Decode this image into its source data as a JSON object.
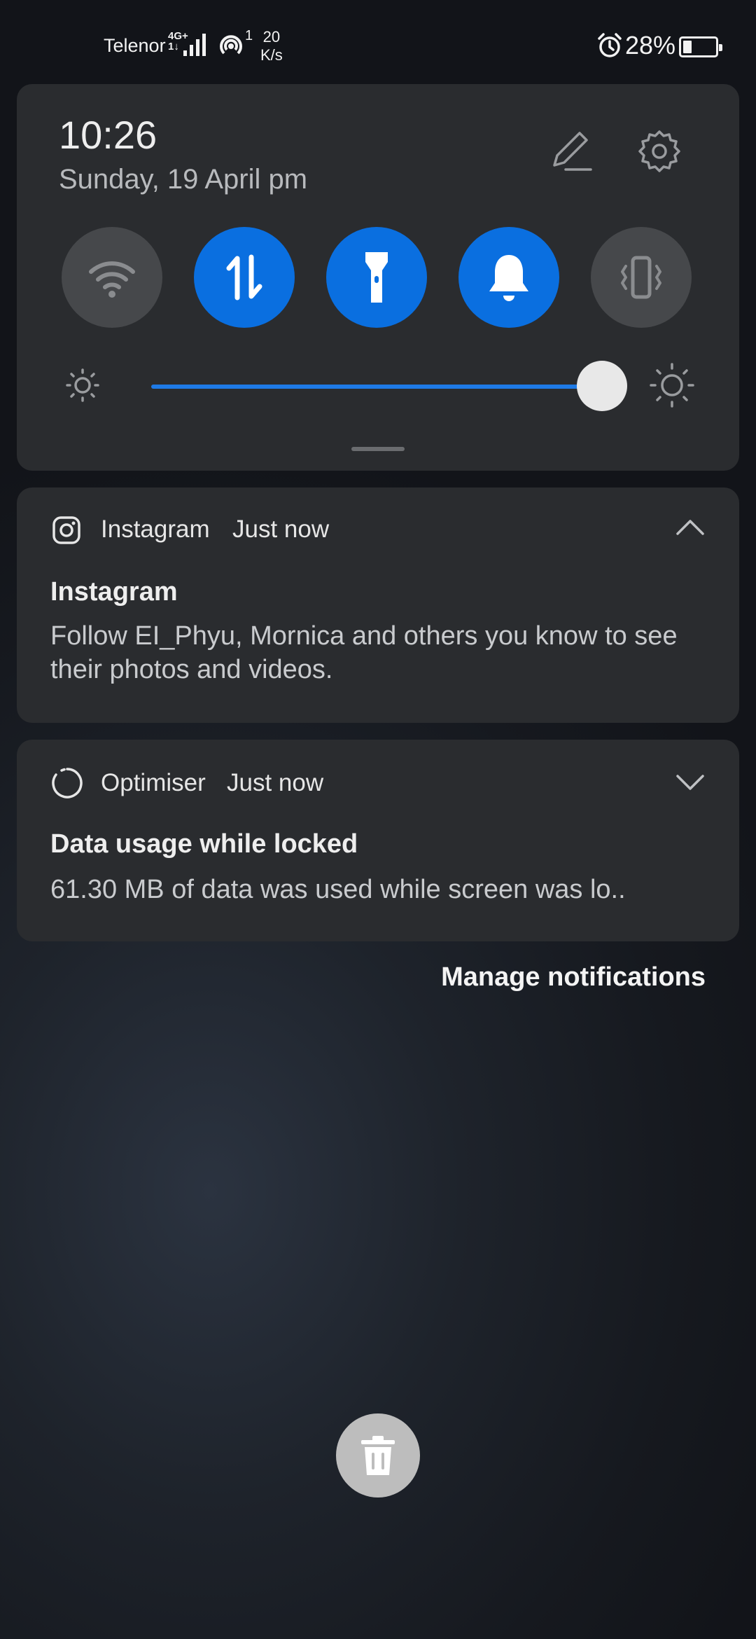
{
  "status_bar": {
    "carrier": "Telenor",
    "network_type": "4G+",
    "network_sub": "1↓",
    "hotspot_count": "1",
    "speed_value": "20",
    "speed_unit": "K/s",
    "battery_percent": "28%",
    "battery_level": 0.28
  },
  "quick_settings": {
    "time": "10:26",
    "date": "Sunday, 19 April  pm",
    "toggles": [
      {
        "name": "wifi",
        "state": "off",
        "icon": "wifi-icon"
      },
      {
        "name": "mobile-data",
        "state": "on",
        "icon": "data-arrows-icon"
      },
      {
        "name": "flashlight",
        "state": "on",
        "icon": "flashlight-icon"
      },
      {
        "name": "sound",
        "state": "on",
        "icon": "bell-icon"
      },
      {
        "name": "vibrate",
        "state": "off",
        "icon": "vibrate-icon"
      }
    ],
    "brightness": 0.9
  },
  "notifications": [
    {
      "app": "Instagram",
      "time": "Just now",
      "title": "Instagram",
      "body": "Follow EI_Phyu, Mornica and others you know to see their photos and videos.",
      "expanded": true
    },
    {
      "app": "Optimiser",
      "time": "Just now",
      "title": "Data usage while locked",
      "body": "61.30 MB of data was used while screen was lo..",
      "expanded": false
    }
  ],
  "manage_label": "Manage notifications",
  "colors": {
    "accent": "#0a6fe0",
    "panel": "#2a2c2f",
    "tile_off": "#46484b"
  }
}
